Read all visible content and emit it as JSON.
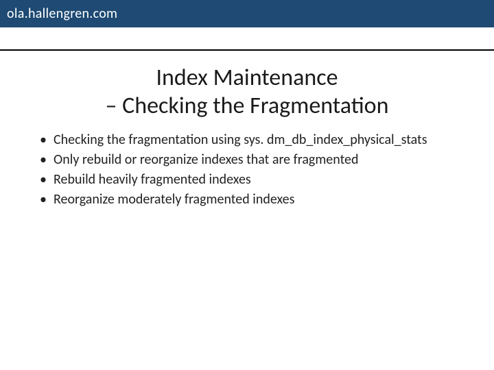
{
  "header": {
    "site": "ola.hallengren.com"
  },
  "title": {
    "line1": "Index Maintenance",
    "line2": "– Checking the Fragmentation"
  },
  "bullets": [
    "Checking the fragmentation using sys. dm_db_index_physical_stats",
    "Only rebuild or reorganize indexes that are fragmented",
    "Rebuild heavily fragmented indexes",
    "Reorganize moderately fragmented indexes"
  ]
}
